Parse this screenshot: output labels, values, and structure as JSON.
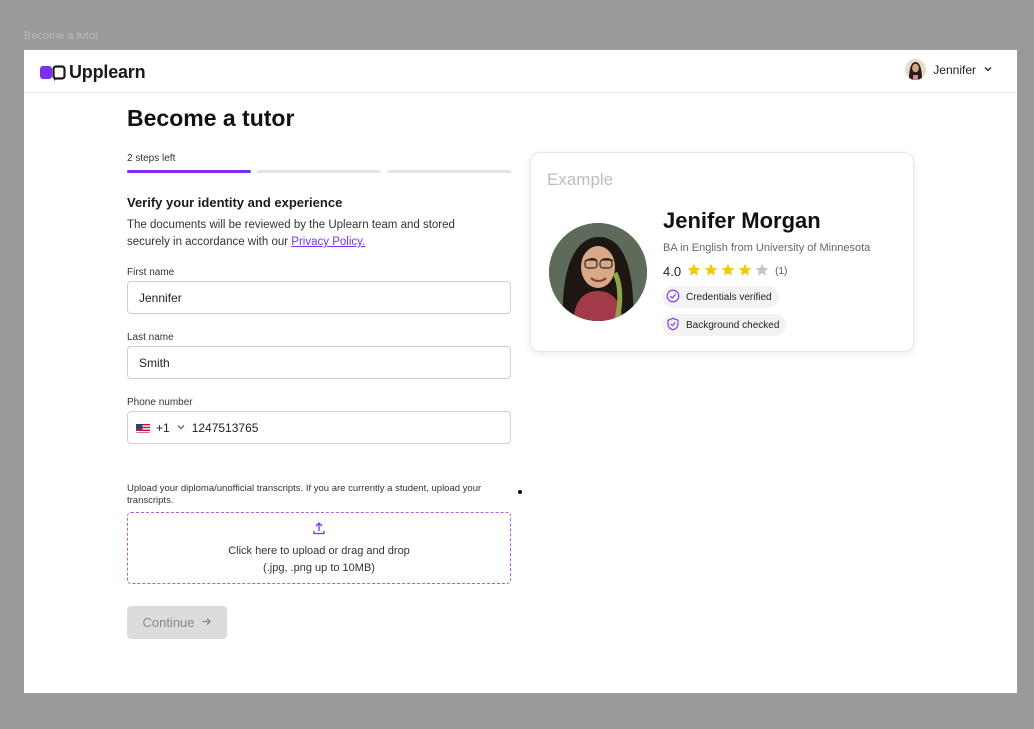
{
  "frame_label": "Become a tutor",
  "brand": {
    "name": "Upplearn",
    "accent": "#7b2ff7"
  },
  "user": {
    "name": "Jennifer",
    "menu_icon": "chevron-down-icon"
  },
  "page": {
    "title": "Become a tutor",
    "steps_label": "2 steps left",
    "progress": {
      "total_steps": 3,
      "completed": 1
    }
  },
  "form": {
    "section_title": "Verify your identity and experience",
    "section_desc": "The documents will be reviewed by the Uplearn team and stored securely in accordance with our",
    "privacy_link": "Privacy Policy.",
    "first_name": {
      "label": "First name",
      "value": "Jennifer"
    },
    "last_name": {
      "label": "Last name",
      "value": "Smith"
    },
    "phone": {
      "label": "Phone number",
      "country_code": "+1",
      "flag": "us-flag-icon",
      "value": "1247513765"
    },
    "upload": {
      "label": "Upload your diploma/unofficial transcripts. If you are currently a student, upload your transcripts.",
      "line1": "Click here to upload or drag and drop",
      "line2": "(.jpg, .png up to 10MB)"
    },
    "continue_label": "Continue"
  },
  "example_card": {
    "label": "Example",
    "name": "Jenifer Morgan",
    "degree": "BA in English from University of Minnesota",
    "rating": "4.0",
    "stars_filled": 4,
    "stars_total": 5,
    "review_count": "(1)",
    "badges": [
      "Credentials verified",
      "Background checked"
    ]
  }
}
